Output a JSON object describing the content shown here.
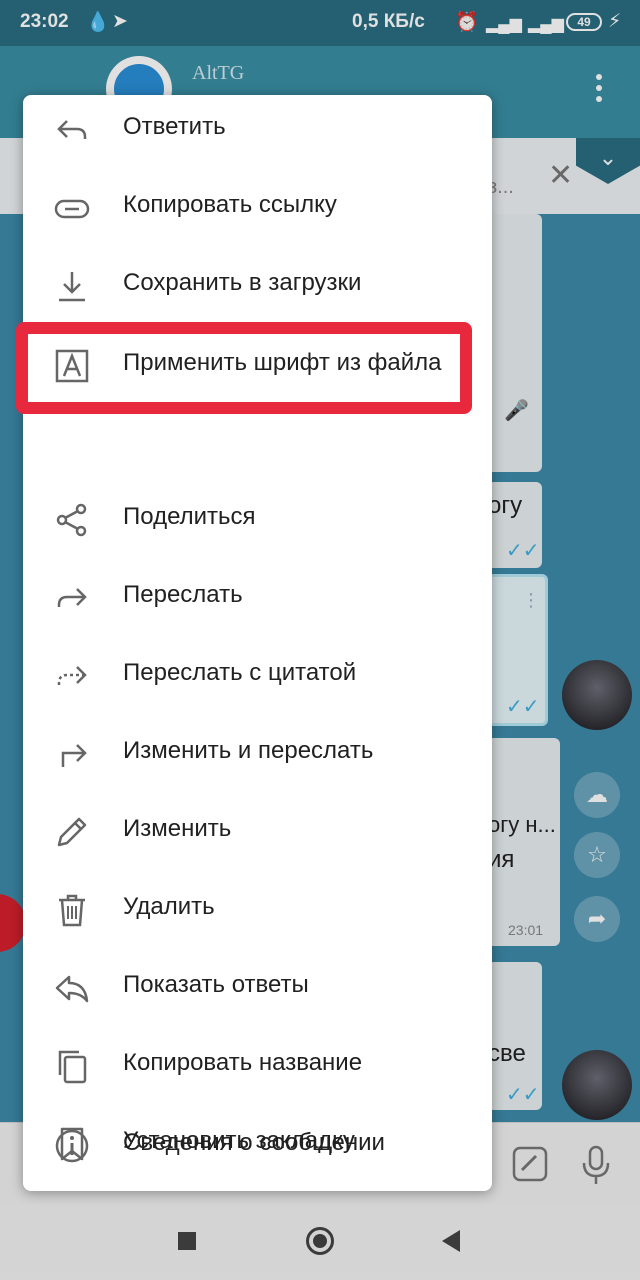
{
  "status_bar": {
    "time": "23:02",
    "network_speed": "0,5 КБ/с",
    "battery": "49"
  },
  "chat_header": {
    "title": "AltTG"
  },
  "chat": {
    "bubble_texts": [
      "огу",
      "огу н...",
      "ия",
      "све"
    ],
    "bubble_time": "23:01",
    "pinned_truncated": "з..."
  },
  "context_menu": {
    "items": [
      {
        "label": "Ответить",
        "icon": "reply-icon"
      },
      {
        "label": "Копировать ссылку",
        "icon": "link-icon"
      },
      {
        "label": "Сохранить в загрузки",
        "icon": "download-icon"
      },
      {
        "label": "Применить шрифт из файла",
        "icon": "font-icon"
      },
      {
        "label": "Поделиться",
        "icon": "share-icon"
      },
      {
        "label": "Переслать",
        "icon": "forward-icon"
      },
      {
        "label": "Переслать с цитатой",
        "icon": "forward-quote-icon"
      },
      {
        "label": "Изменить и переслать",
        "icon": "edit-forward-icon"
      },
      {
        "label": "Изменить",
        "icon": "pencil-icon"
      },
      {
        "label": "Удалить",
        "icon": "trash-icon"
      },
      {
        "label": "Показать ответы",
        "icon": "replies-icon"
      },
      {
        "label": "Копировать название",
        "icon": "copy-icon"
      },
      {
        "label": "Установить закладку",
        "icon": "bookmark-icon"
      },
      {
        "label": "Сведения о сообщении",
        "icon": "info-icon"
      }
    ]
  },
  "colors": {
    "highlight": "#e8283d",
    "header": "#2a6e82",
    "check": "#3fb0e0"
  }
}
